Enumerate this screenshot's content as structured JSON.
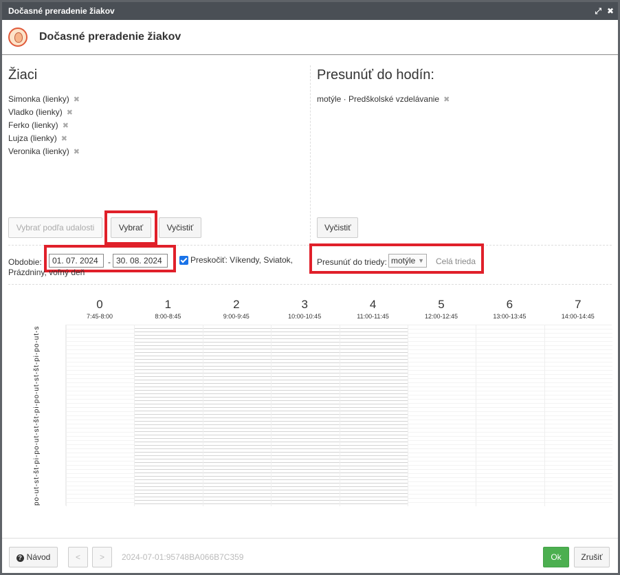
{
  "window": {
    "title": "Dočasné preradenie žiakov",
    "close_symbol": "✖",
    "expand_symbol": "⤢"
  },
  "header": {
    "title": "Dočasné preradenie žiakov"
  },
  "students": {
    "title": "Žiaci",
    "items": [
      {
        "label": "Simonka (lienky)"
      },
      {
        "label": "Vladko (lienky)"
      },
      {
        "label": "Ferko (lienky)"
      },
      {
        "label": "Lujza (lienky)"
      },
      {
        "label": "Veronika (lienky)"
      }
    ],
    "remove_symbol": "✖",
    "buttons": {
      "by_event": "Vybrať podľa udalosti",
      "select": "Vybrať",
      "clear": "Vyčistiť"
    }
  },
  "target": {
    "title": "Presunúť do hodín:",
    "items": [
      {
        "label": "motýle · Predškolské vzdelávanie"
      }
    ],
    "remove_symbol": "✖",
    "clear": "Vyčistiť"
  },
  "filters": {
    "period_label": "Obdobie:",
    "date_from": "01. 07. 2024",
    "date_sep": "-",
    "date_to": "30. 08. 2024",
    "skip_label": "Preskočiť: Víkendy, Sviatok,",
    "skip_label_line2": "Prázdniny, voľný deň",
    "skip_checked": true,
    "move_class_label": "Presunúť do triedy:",
    "class_value": "motýle",
    "whole_class": "Celá trieda"
  },
  "periods": [
    {
      "num": "0",
      "time": "7:45-8:00",
      "state": "empty"
    },
    {
      "num": "1",
      "time": "8:00-8:45",
      "state": "hatched"
    },
    {
      "num": "2",
      "time": "9:00-9:45",
      "state": "hatched"
    },
    {
      "num": "3",
      "time": "10:00-10:45",
      "state": "hatched"
    },
    {
      "num": "4",
      "time": "11:00-11:45",
      "state": "hatched"
    },
    {
      "num": "5",
      "time": "12:00-12:45",
      "state": "empty"
    },
    {
      "num": "6",
      "time": "13:00-13:45",
      "state": "empty"
    },
    {
      "num": "7",
      "time": "14:00-14:45",
      "state": "empty"
    }
  ],
  "row_labels_text": "po-ut-st-št-pi-po-ut-st-št-pi-po-ut-st-št-pi-po-ut-st-št-pi-po-ut-st-št-pi-po-ut-st-št-pi-po-ut-st",
  "footer": {
    "help": "Návod",
    "prev": "<",
    "next": ">",
    "status_id": "2024-07-01:95748BA066B7C359",
    "ok": "Ok",
    "cancel": "Zrušiť"
  }
}
